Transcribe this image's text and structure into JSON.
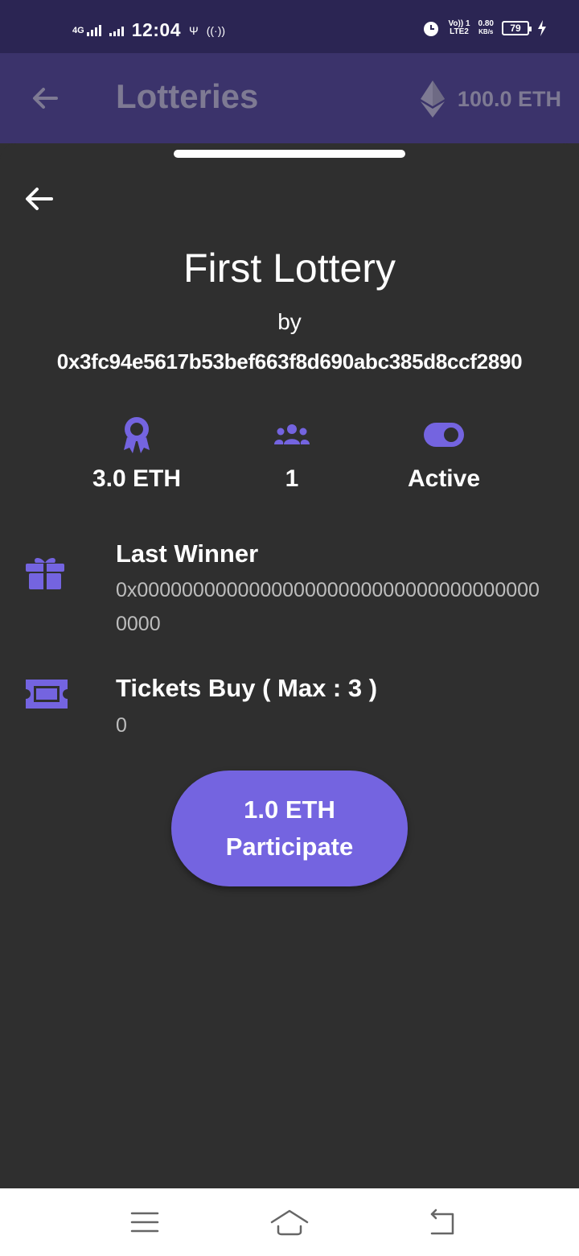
{
  "status_bar": {
    "network": "4G",
    "time": "12:04",
    "volte": "Vo)) 1",
    "lte": "LTE2",
    "speed_value": "0.80",
    "speed_unit": "KB/s",
    "battery": "79"
  },
  "app_bar": {
    "title": "Lotteries",
    "balance": "100.0 ETH",
    "icons": [
      "back-arrow-icon",
      "ethereum-icon"
    ]
  },
  "sheet": {
    "title": "First Lottery",
    "by_label": "by",
    "creator_address": "0x3fc94e5617b53bef663f8d690abc385d8ccf2890",
    "stats": {
      "prize": "3.0 ETH",
      "participants": "1",
      "status": "Active"
    },
    "last_winner": {
      "label": "Last Winner",
      "value": "0x0000000000000000000000000000000000000000"
    },
    "tickets": {
      "label": "Tickets Buy ( Max : 3 )",
      "value": "0"
    },
    "participate_button": {
      "price": "1.0 ETH",
      "label": "Participate"
    },
    "accent_color": "#7464e0"
  },
  "nav_bar": {
    "icons": [
      "menu-icon",
      "home-icon",
      "back-icon"
    ]
  }
}
